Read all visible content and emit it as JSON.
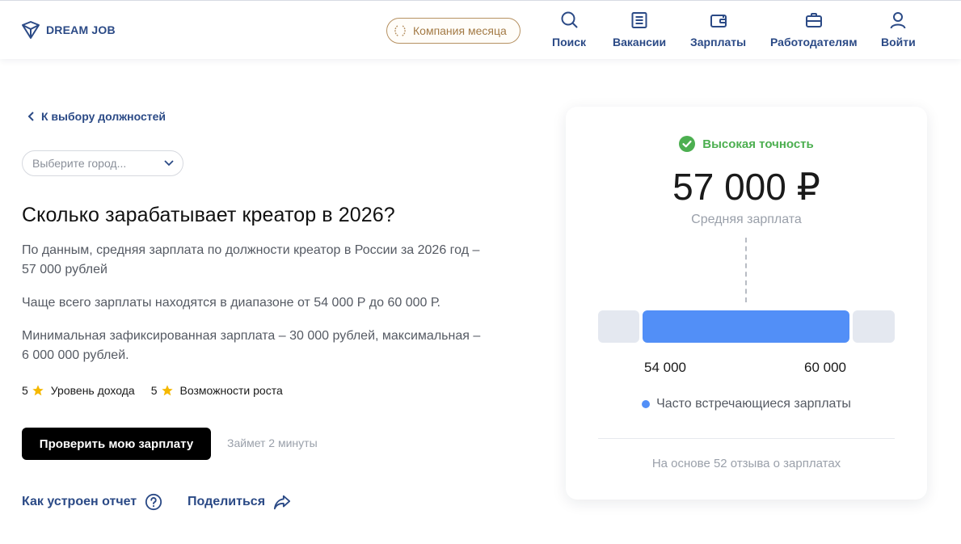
{
  "header": {
    "logo_text": "DREAM JOB",
    "company_month": "Компания месяца",
    "nav": [
      {
        "label": "Поиск",
        "icon": "search-icon"
      },
      {
        "label": "Вакансии",
        "icon": "list-icon"
      },
      {
        "label": "Зарплаты",
        "icon": "wallet-icon"
      },
      {
        "label": "Работодателям",
        "icon": "briefcase-icon"
      },
      {
        "label": "Войти",
        "icon": "user-icon"
      }
    ]
  },
  "main": {
    "back_link": "К выбору должностей",
    "city_placeholder": "Выберите город...",
    "title": "Сколько зарабатывает креатор в 2026?",
    "paragraphs": [
      "По данным, средняя зарплата по должности креатор в России за 2026 год – 57 000 рублей",
      "Чаще всего зарплаты находятся в диапазоне от 54 000 Р до 60 000 Р.",
      "Минимальная зафиксированная зарплата – 30 000 рублей, максимальная – 6 000 000 рублей."
    ],
    "ratings": [
      {
        "score": "5",
        "label": "Уровень дохода"
      },
      {
        "score": "5",
        "label": "Возможности роста"
      }
    ],
    "check_button": "Проверить мою зарплату",
    "time_note": "Займет 2 минуты",
    "how_report_link": "Как устроен отчет",
    "share_link": "Поделиться"
  },
  "card": {
    "accuracy": "Высокая точность",
    "avg_salary": "57 000 ₽",
    "avg_label": "Средняя зарплата",
    "range_low": "54 000",
    "range_high": "60 000",
    "legend": "Часто встречающиеся зарплаты",
    "reviews": "На основе 52 отзыва о зарплатах"
  },
  "colors": {
    "brand": "#2b4a86",
    "accent_blue": "#528ff7",
    "success": "#4caf50",
    "gold": "#b69162",
    "star": "#f5b800"
  }
}
